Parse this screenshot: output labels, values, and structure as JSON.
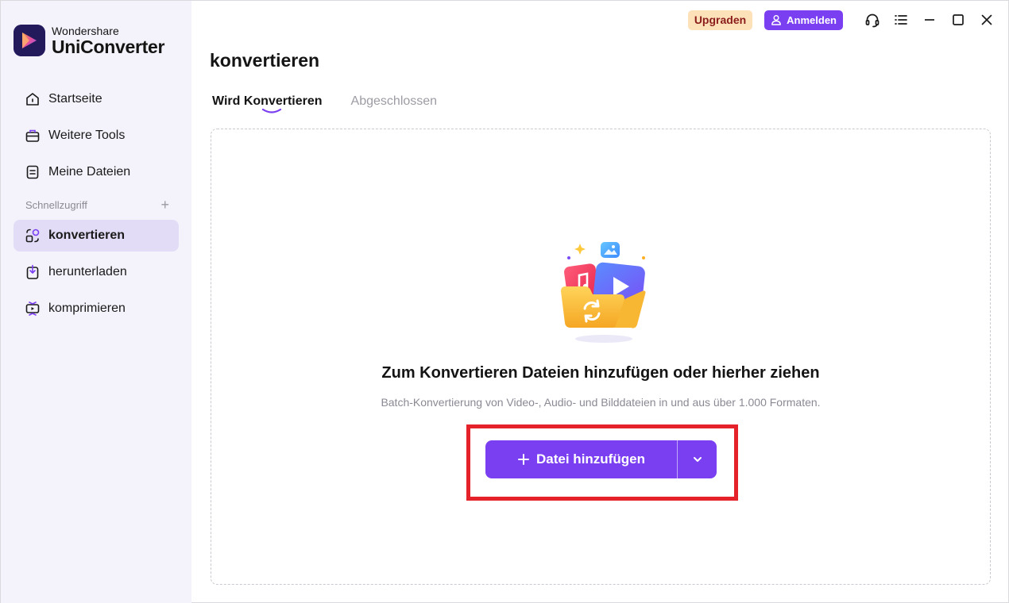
{
  "app": {
    "brand_line1": "Wondershare",
    "brand_line2": "UniConverter"
  },
  "sidebar": {
    "items": [
      {
        "label": "Startseite",
        "icon": "home-icon"
      },
      {
        "label": "Weitere Tools",
        "icon": "toolbox-icon"
      },
      {
        "label": "Meine Dateien",
        "icon": "file-icon"
      }
    ],
    "quick_access_label": "Schnellzugriff",
    "quick_items": [
      {
        "label": "konvertieren",
        "icon": "convert-icon",
        "active": true
      },
      {
        "label": "herunterladen",
        "icon": "download-icon"
      },
      {
        "label": "komprimieren",
        "icon": "compress-icon"
      }
    ]
  },
  "topbar": {
    "upgrade_label": "Upgraden",
    "login_label": "Anmelden",
    "icons": [
      "headset-icon",
      "menu-icon",
      "minimize-icon",
      "maximize-icon",
      "close-icon"
    ]
  },
  "main": {
    "title": "konvertieren",
    "tabs": [
      {
        "label": "Wird Konvertieren",
        "active": true
      },
      {
        "label": "Abgeschlossen",
        "active": false
      }
    ],
    "drop_title": "Zum Konvertieren Dateien hinzufügen oder hierher ziehen",
    "drop_subtitle": "Batch-Konvertierung von Video-, Audio- und Bilddateien in und aus über 1.000 Formaten.",
    "add_button_label": "Datei hinzufügen"
  },
  "colors": {
    "accent": "#7b3ff2",
    "sidebar_bg": "#f4f3fb",
    "active_item_bg": "#e3dcf7",
    "highlight": "#e5212a",
    "upgrade_bg": "#fde1b8",
    "upgrade_text": "#8b1c1c"
  }
}
